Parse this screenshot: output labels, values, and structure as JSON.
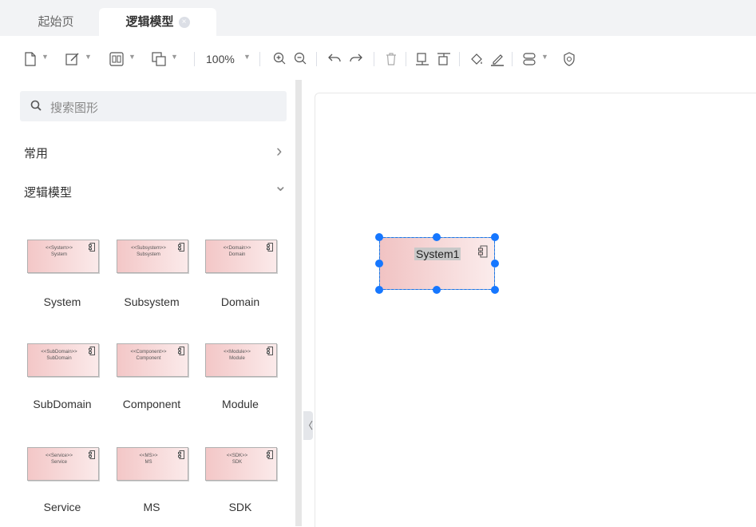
{
  "tabs": [
    {
      "label": "起始页"
    },
    {
      "label": "逻辑模型",
      "close": "×"
    }
  ],
  "toolbar": {
    "zoom": "100%"
  },
  "sidebar": {
    "search_placeholder": "搜索图形",
    "categories": [
      {
        "label": "常用",
        "chevron": "›"
      },
      {
        "label": "逻辑模型",
        "chevron": "⌄"
      }
    ],
    "shapes": [
      {
        "stereotype": "<<System>>",
        "name": "System",
        "label": "System"
      },
      {
        "stereotype": "<<Subsystem>>",
        "name": "Subsystem",
        "label": "Subsystem"
      },
      {
        "stereotype": "<<Domain>>",
        "name": "Domain",
        "label": "Domain"
      },
      {
        "stereotype": "<<SubDomain>>",
        "name": "SubDomain",
        "label": "SubDomain"
      },
      {
        "stereotype": "<<Component>>",
        "name": "Component",
        "label": "Component"
      },
      {
        "stereotype": "<<Module>>",
        "name": "Module",
        "label": "Module"
      },
      {
        "stereotype": "<<Service>>",
        "name": "Service",
        "label": "Service"
      },
      {
        "stereotype": "<<MS>>",
        "name": "MS",
        "label": "MS"
      },
      {
        "stereotype": "<<SDK>>",
        "name": "SDK",
        "label": "SDK"
      }
    ],
    "collapse_glyph": "〈"
  },
  "canvas": {
    "node_label": "System1"
  },
  "colors": {
    "accent": "#1677ff",
    "shape_fill_start": "#f3c7c7",
    "shape_fill_end": "#fbeaea"
  }
}
